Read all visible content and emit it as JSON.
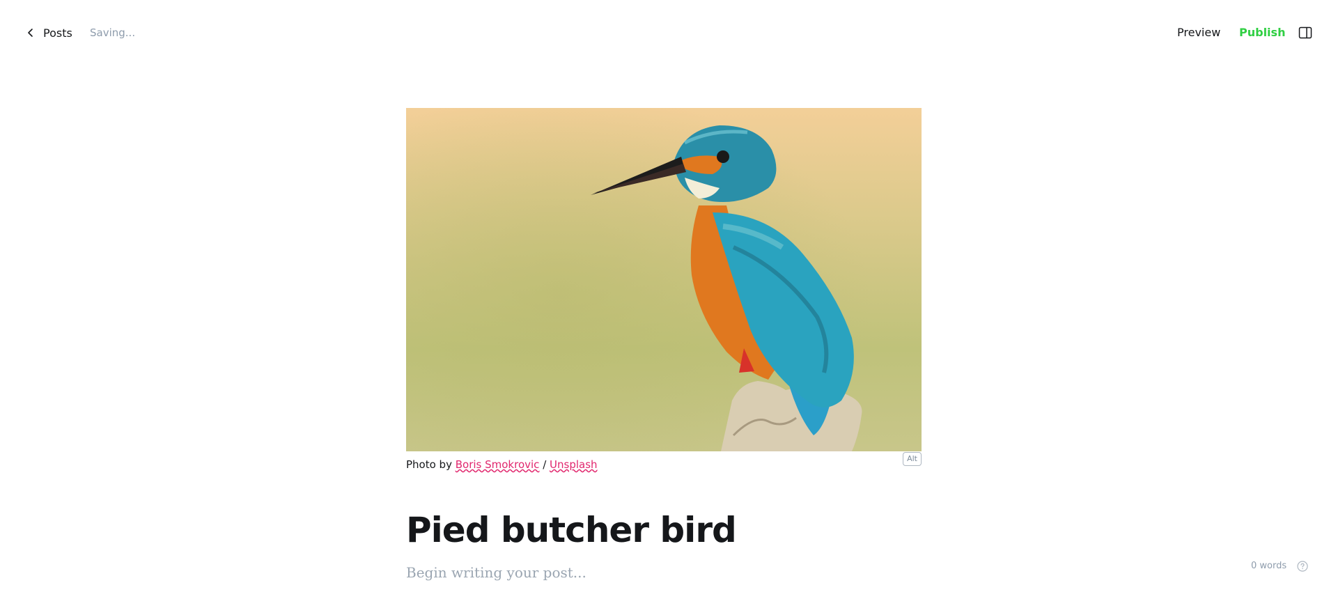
{
  "header": {
    "back_label": "Posts",
    "status": "Saving...",
    "preview_label": "Preview",
    "publish_label": "Publish",
    "publish_color": "#30cf43"
  },
  "feature_image": {
    "caption_prefix": "Photo by ",
    "author": "Boris Smokrovic",
    "separator": " / ",
    "source": "Unsplash",
    "alt_button": "Alt",
    "link_color": "#e1266d"
  },
  "post": {
    "title": "Pied butcher bird",
    "body_placeholder": "Begin writing your post..."
  },
  "footer": {
    "word_count": "0 words"
  },
  "icons": {
    "back": "chevron-left-icon",
    "sidebar": "sidebar-toggle-icon",
    "help": "question-circle-icon"
  }
}
